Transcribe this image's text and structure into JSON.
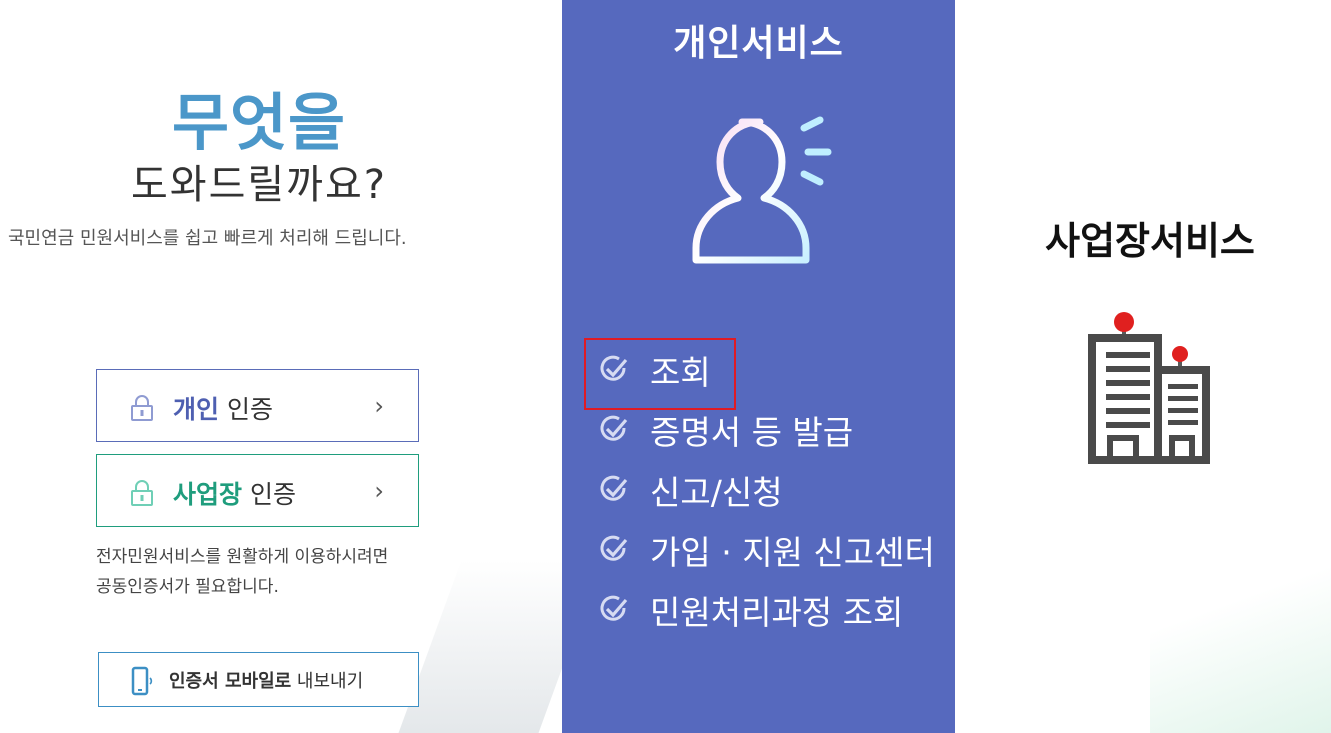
{
  "left": {
    "headline_1": "무엇을",
    "headline_2": "도와드릴까요?",
    "subtitle": "국민연금 민원서비스를 쉽고 빠르게 처리해 드립니다.",
    "personal_auth": {
      "highlight": "개인",
      "rest": "인증",
      "icon": "lock-icon"
    },
    "business_auth": {
      "highlight": "사업장",
      "rest": "인증",
      "icon": "lock-icon"
    },
    "auth_note_line1": "전자민원서비스를 원활하게 이용하시려면",
    "auth_note_line2": "공동인증서가 필요합니다.",
    "mobile_export": {
      "bold": "인증서 모바일로",
      "rest": "내보내기",
      "icon": "phone-icon"
    }
  },
  "center": {
    "title": "개인서비스",
    "icon": "person-icon",
    "menu": [
      {
        "label": "조회",
        "selected": true
      },
      {
        "label": "증명서 등 발급"
      },
      {
        "label": "신고/신청"
      },
      {
        "label": "가입 · 지원 신고센터"
      },
      {
        "label": "민원처리과정 조회"
      }
    ]
  },
  "right": {
    "title": "사업장서비스",
    "icon": "building-icon"
  },
  "colors": {
    "personal_accent": "#4e5fb1",
    "business_accent": "#1f9d7d",
    "headline_blue": "#4b97c9",
    "center_panel_bg": "#5669be",
    "selection_red": "#e01b24"
  }
}
